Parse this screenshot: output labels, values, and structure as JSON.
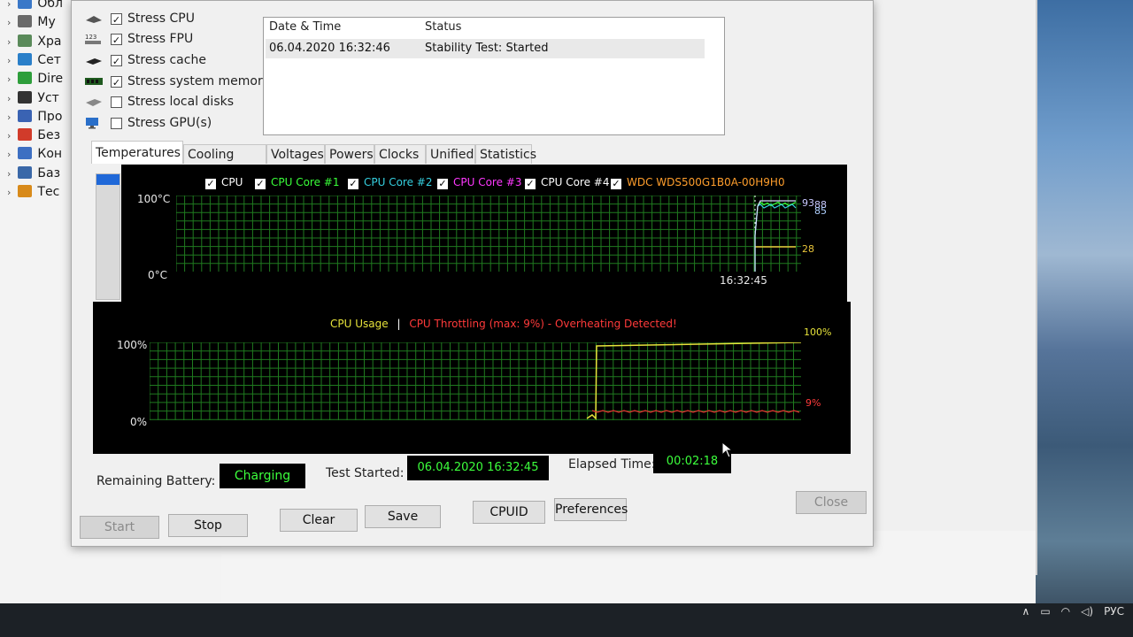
{
  "explorer": {
    "items": [
      {
        "label": "Обл",
        "icon_color": "#3a78c8"
      },
      {
        "label": "Му",
        "icon_color": "#6a6a6a"
      },
      {
        "label": "Хра",
        "icon_color": "#5a8a5a"
      },
      {
        "label": "Сет",
        "icon_color": "#2a7fc9"
      },
      {
        "label": "Dire",
        "icon_color": "#2e9e3b"
      },
      {
        "label": "Уст",
        "icon_color": "#333333"
      },
      {
        "label": "Про",
        "icon_color": "#3a63b3"
      },
      {
        "label": "Без",
        "icon_color": "#d13b2a"
      },
      {
        "label": "Кон",
        "icon_color": "#3d6fc2"
      },
      {
        "label": "Баз",
        "icon_color": "#3a68a8"
      },
      {
        "label": "Тес",
        "icon_color": "#d88a1a"
      }
    ]
  },
  "stress": {
    "items": [
      {
        "label": "Stress CPU",
        "checked": "✓"
      },
      {
        "label": "Stress FPU",
        "checked": "✓"
      },
      {
        "label": "Stress cache",
        "checked": "✓"
      },
      {
        "label": "Stress system memory",
        "checked": "✓"
      },
      {
        "label": "Stress local disks",
        "checked": ""
      },
      {
        "label": "Stress GPU(s)",
        "checked": ""
      }
    ]
  },
  "status_list": {
    "col_datetime": "Date & Time",
    "col_status": "Status",
    "rows": [
      {
        "datetime": "06.04.2020 16:32:46",
        "status": "Stability Test: Started"
      }
    ]
  },
  "tabs": [
    "Temperatures",
    "Cooling Fans",
    "Voltages",
    "Powers",
    "Clocks",
    "Unified",
    "Statistics"
  ],
  "temp_chart": {
    "legend": [
      {
        "label": "CPU",
        "color": "#ffffff"
      },
      {
        "label": "CPU Core #1",
        "color": "#39ff39"
      },
      {
        "label": "CPU Core #2",
        "color": "#35d0e0"
      },
      {
        "label": "CPU Core #3",
        "color": "#ff38ff"
      },
      {
        "label": "CPU Core #4",
        "color": "#ffffff"
      },
      {
        "label": "WDC WDS500G1B0A-00H9H0",
        "color": "#ff9e2c"
      }
    ],
    "y_top": "100°C",
    "y_bottom": "0°C",
    "time_label": "16:32:45",
    "val_a": "93",
    "val_b": "88",
    "val_c": "85",
    "val_disk": "28"
  },
  "usage_chart": {
    "title_usage": "CPU Usage",
    "separator": "|",
    "title_throttle": "CPU Throttling (max: 9%) - Overheating Detected!",
    "y_top": "100%",
    "y_bottom": "0%",
    "val_usage": "100%",
    "val_throttle": "9%"
  },
  "status_bar": {
    "battery_label": "Remaining Battery:",
    "battery_value": "Charging",
    "test_started_label": "Test Started:",
    "test_started_value": "06.04.2020 16:32:45",
    "elapsed_label": "Elapsed Time:",
    "elapsed_value": "00:02:18"
  },
  "buttons": {
    "start": "Start",
    "stop": "Stop",
    "clear": "Clear",
    "save": "Save",
    "cpuid": "CPUID",
    "preferences": "Preferences",
    "close": "Close"
  },
  "tray": {
    "language": "РУС"
  },
  "colors": {
    "grid": "#1f7a1f",
    "usage_line": "#e6e23a",
    "throttle_line": "#e03030",
    "lcd_text": "#3cff3c"
  }
}
